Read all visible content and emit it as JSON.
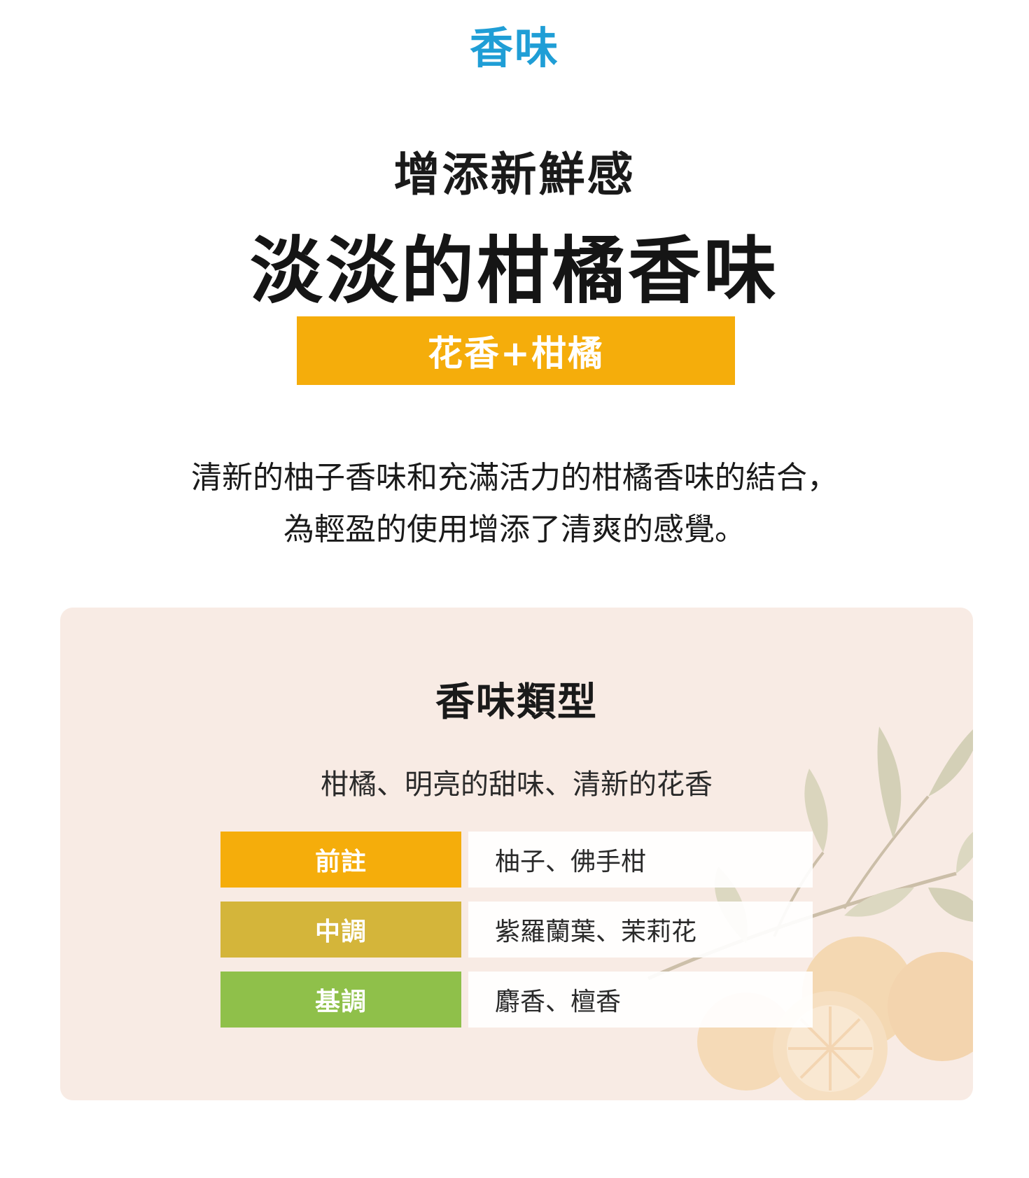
{
  "section_tag": "香味",
  "subtitle": "增添新鮮感",
  "headline": "淡淡的柑橘香味",
  "badge": "花香+柑橘",
  "description": {
    "line1": "清新的柚子香味和充滿活力的柑橘香味的結合，",
    "line2": "為輕盈的使用增添了清爽的感覺。"
  },
  "panel": {
    "title": "香味類型",
    "subtitle": "柑橘、明亮的甜味、清新的花香",
    "notes": [
      {
        "label": "前註",
        "value": "柚子、佛手柑",
        "color": "#f5ad0b"
      },
      {
        "label": "中調",
        "value": "紫羅蘭葉、茉莉花",
        "color": "#d4b53a"
      },
      {
        "label": "基調",
        "value": "麝香、檀香",
        "color": "#8fc04a"
      }
    ],
    "background_color": "#f8ebe4"
  },
  "colors": {
    "accent_blue": "#1f9ed6",
    "badge_orange": "#f5ad0b"
  }
}
